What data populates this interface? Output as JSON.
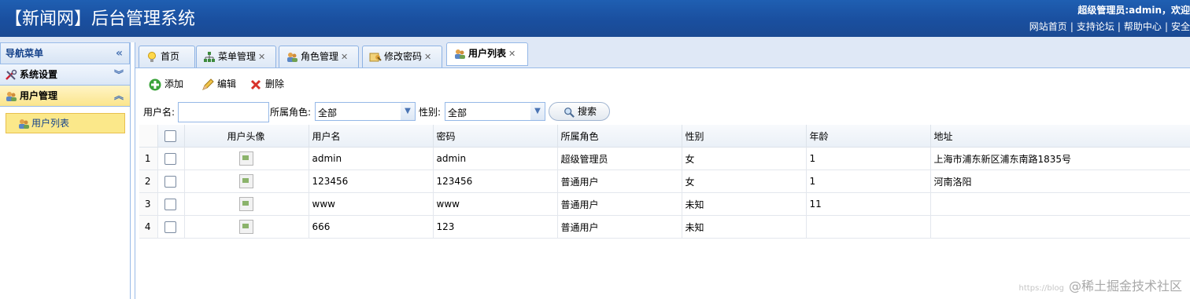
{
  "header": {
    "title": "【新闻网】后台管理系统",
    "welcome": "超级管理员:admin，欢迎",
    "links": [
      "网站首页",
      "支持论坛",
      "帮助中心",
      "安全"
    ]
  },
  "nav": {
    "title": "导航菜单",
    "sections": [
      {
        "label": "系统设置",
        "icon": "tools-icon",
        "expanded": false
      },
      {
        "label": "用户管理",
        "icon": "users-icon",
        "expanded": true
      }
    ],
    "items": [
      {
        "label": "用户列表",
        "icon": "users-icon",
        "selected": true
      }
    ]
  },
  "tabs": [
    {
      "label": "首页",
      "icon": "lightbulb-icon",
      "closable": false,
      "selected": false
    },
    {
      "label": "菜单管理",
      "icon": "sitemap-icon",
      "closable": true,
      "selected": false
    },
    {
      "label": "角色管理",
      "icon": "users-icon",
      "closable": true,
      "selected": false
    },
    {
      "label": "修改密码",
      "icon": "key-icon",
      "closable": true,
      "selected": false
    },
    {
      "label": "用户列表",
      "icon": "users-icon",
      "closable": true,
      "selected": true
    }
  ],
  "toolbar": {
    "add_label": "添加",
    "edit_label": "编辑",
    "delete_label": "删除"
  },
  "search": {
    "username_label": "用户名:",
    "username_value": "",
    "role_label": "所属角色:",
    "role_value": "全部",
    "gender_label": "性别:",
    "gender_value": "全部",
    "search_label": "搜索"
  },
  "grid": {
    "columns": [
      "用户头像",
      "用户名",
      "密码",
      "所属角色",
      "性别",
      "年龄",
      "地址"
    ],
    "rows": [
      {
        "n": "1",
        "username": "admin",
        "password": "admin",
        "role": "超级管理员",
        "gender": "女",
        "age": "1",
        "address": "上海市浦东新区浦东南路1835号"
      },
      {
        "n": "2",
        "username": "123456",
        "password": "123456",
        "role": "普通用户",
        "gender": "女",
        "age": "1",
        "address": "河南洛阳"
      },
      {
        "n": "3",
        "username": "www",
        "password": "www",
        "role": "普通用户",
        "gender": "未知",
        "age": "11",
        "address": ""
      },
      {
        "n": "4",
        "username": "666",
        "password": "123",
        "role": "普通用户",
        "gender": "未知",
        "age": "",
        "address": ""
      }
    ]
  },
  "watermark": {
    "url": "https://blog",
    "text": "@稀土掘金技术社区"
  }
}
